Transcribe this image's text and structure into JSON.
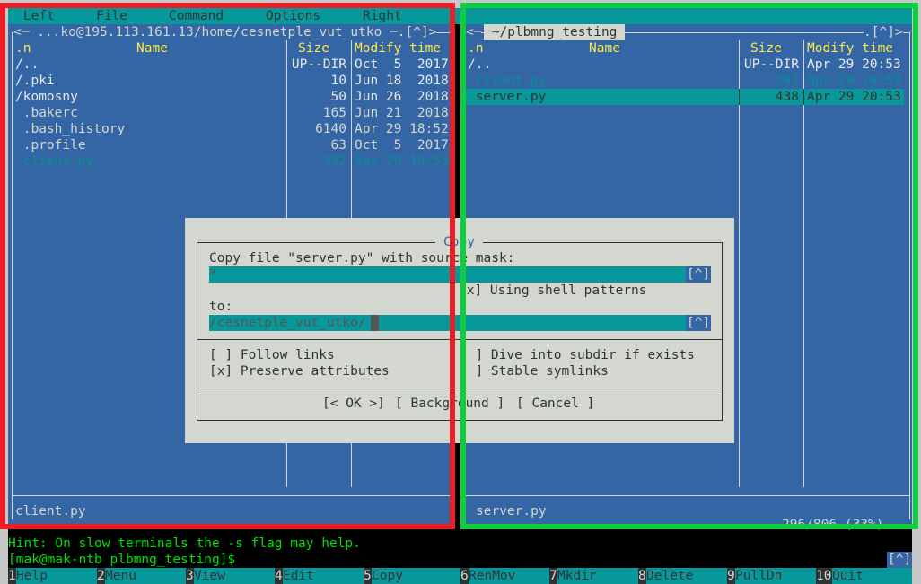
{
  "menubar": [
    "Left",
    "File",
    "Command",
    "Options",
    "Right"
  ],
  "left_panel": {
    "path": "<─ ...ko@195.113.161.13/home/cesnetple_vut_utko ─.[^]>",
    "headers": {
      "n": ".n",
      "name": "Name",
      "size": "Size",
      "time": "Modify time"
    },
    "rows": [
      {
        "name": "/..",
        "size": "UP--DIR",
        "time": "Oct  5  2017",
        "kind": "dir"
      },
      {
        "name": "/.pki",
        "size": "10",
        "time": "Jun 18  2018",
        "kind": "dir"
      },
      {
        "name": "/komosny",
        "size": "50",
        "time": "Jun 26  2018",
        "kind": "dir"
      },
      {
        "name": " .bakerc",
        "size": "165",
        "time": "Jun 21  2018",
        "kind": "file"
      },
      {
        "name": " .bash_history",
        "size": "6140",
        "time": "Apr 29 18:52",
        "kind": "file"
      },
      {
        "name": " .profile",
        "size": "63",
        "time": "Oct  5  2017",
        "kind": "file"
      },
      {
        "name": " client.py",
        "size": "392",
        "time": "Apr 29 18:53",
        "kind": "exec"
      }
    ],
    "status": "client.py"
  },
  "right_panel": {
    "path_left": "<─",
    "path": " ~/plbmng_testing ",
    "path_right": ".[^]>",
    "headers": {
      "n": ".n",
      "name": "Name",
      "size": "Size",
      "time": "Modify time"
    },
    "rows": [
      {
        "name": "/..",
        "size": "UP--DIR",
        "time": "Apr 29 20:53",
        "kind": "dir"
      },
      {
        "name": " client.py",
        "size": "392",
        "time": "Apr 29 20:53",
        "kind": "exec"
      },
      {
        "name": " server.py",
        "size": "438",
        "time": "Apr 29 20:53",
        "kind": "selected"
      }
    ],
    "status": "server.py",
    "disk": "296/806 (33%)"
  },
  "dialog": {
    "title": "Copy",
    "source_label": "Copy file \"server.py\" with source mask:",
    "source_value": "*",
    "history_btn": "[^]",
    "shell_patterns": "[x] Using shell patterns",
    "to_label": "to:",
    "to_value": "/cesnetple_vut_utko/",
    "follow_links": "[ ] Follow links",
    "preserve_attrs": "[x] Preserve attributes",
    "dive_subdir": "[ ] Dive into subdir if exists",
    "stable_symlinks": "[ ] Stable symlinks",
    "ok": "[< OK >]",
    "background": "[ Background ]",
    "cancel": "[ Cancel ]"
  },
  "hint": "Hint: On slow terminals the -s flag may help.",
  "prompt": "[mak@mak-ntb plbmng_testing]$",
  "prompt_history": "[^]",
  "keybar": [
    {
      "n": "1",
      "label": "Help"
    },
    {
      "n": "2",
      "label": "Menu"
    },
    {
      "n": "3",
      "label": "View"
    },
    {
      "n": "4",
      "label": "Edit"
    },
    {
      "n": "5",
      "label": "Copy"
    },
    {
      "n": "6",
      "label": "RenMov"
    },
    {
      "n": "7",
      "label": "Mkdir"
    },
    {
      "n": "8",
      "label": "Delete"
    },
    {
      "n": "9",
      "label": "PullDn"
    },
    {
      "n": "10",
      "label": "Quit"
    }
  ],
  "overlay_colors": {
    "left": "#ee1c24",
    "right": "#0ece3e"
  }
}
